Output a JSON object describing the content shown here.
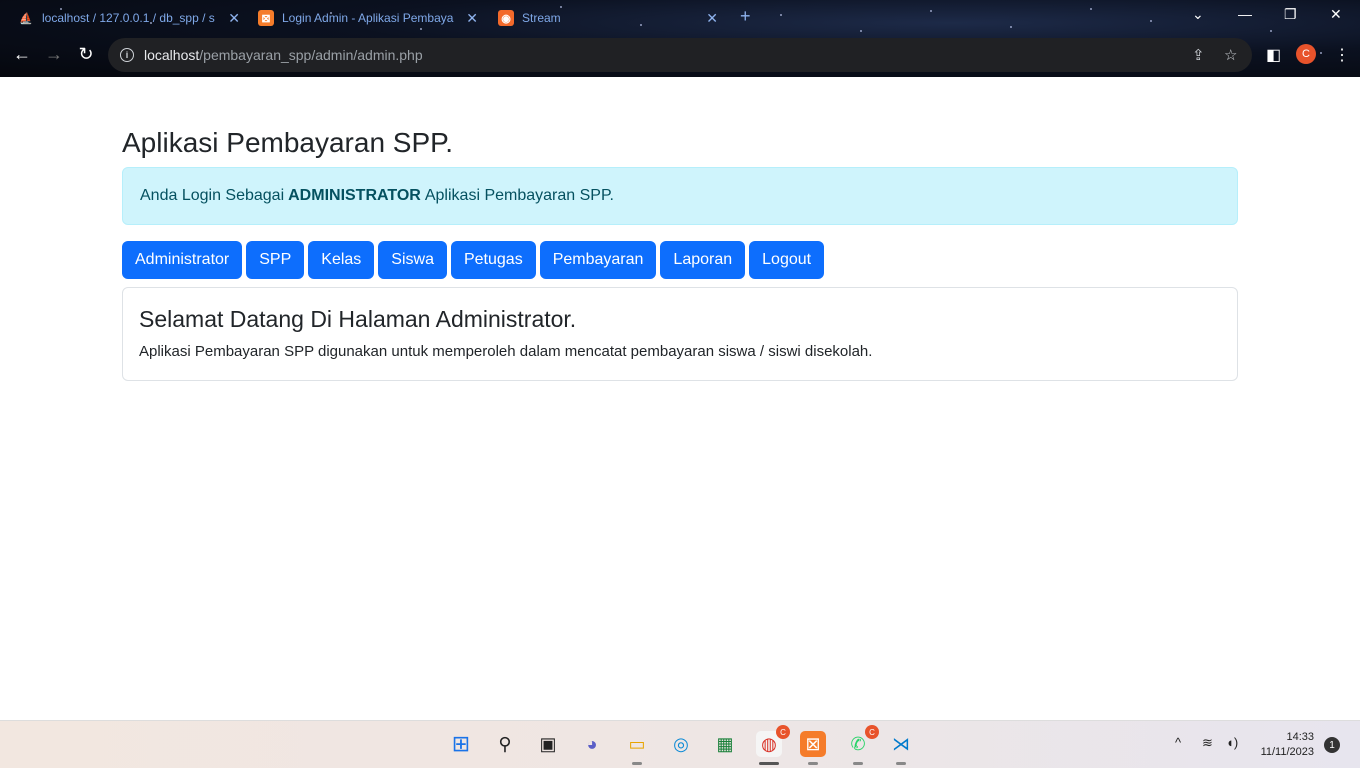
{
  "browser": {
    "tabs": [
      {
        "title": "localhost / 127.0.0.1 / db_spp / s",
        "favicon": "phpmyadmin-icon"
      },
      {
        "title": "Login Admin - Aplikasi Pembaya",
        "favicon": "xampp-icon"
      },
      {
        "title": "Stream",
        "favicon": "stream-icon"
      }
    ],
    "url_host": "localhost",
    "url_path": "/pembayaran_spp/admin/admin.php",
    "profile_initial": "C"
  },
  "page": {
    "title": "Aplikasi Pembayaran SPP.",
    "alert": {
      "prefix": "Anda Login Sebagai",
      "role": "ADMINISTRATOR",
      "suffix": "Aplikasi Pembayaran SPP."
    },
    "nav": [
      "Administrator",
      "SPP",
      "Kelas",
      "Siswa",
      "Petugas",
      "Pembayaran",
      "Laporan",
      "Logout"
    ],
    "card": {
      "heading": "Selamat Datang Di Halaman Administrator.",
      "text": "Aplikasi Pembayaran SPP digunakan untuk memperoleh dalam mencatat pembayaran siswa / siswi disekolah."
    }
  },
  "taskbar": {
    "time": "14:33",
    "date": "11/11/2023",
    "notification_count": "1",
    "chrome_badge": "C",
    "whatsapp_badge": "C"
  },
  "colors": {
    "primary": "#0d6efd",
    "alert_bg": "#cff4fc",
    "alert_text": "#055160"
  }
}
